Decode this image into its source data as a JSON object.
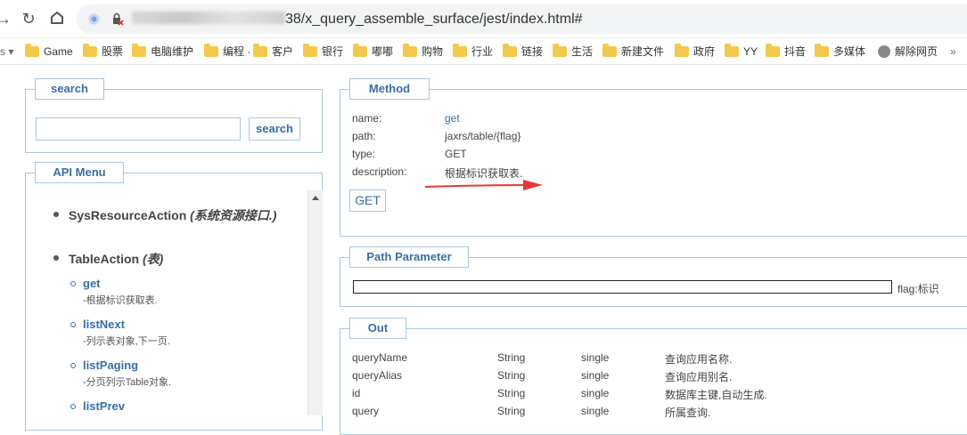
{
  "browser": {
    "url_suffix": "38/x_query_assemble_surface/jest/index.html#",
    "bookmarks": [
      "Game",
      "股票",
      "电脑维护",
      "编程",
      "客户",
      "银行",
      "嘟嘟",
      "购物",
      "行业",
      "链接",
      "生活",
      "新建文件",
      "政府",
      "YY",
      "抖音",
      "多媒体",
      "解除网页"
    ]
  },
  "search": {
    "legend": "search",
    "input_value": "",
    "button_label": "search"
  },
  "menu": {
    "legend": "API Menu",
    "groups": [
      {
        "name": "SysResourceAction",
        "desc": "(系统资源接口.)"
      },
      {
        "name": "TableAction",
        "desc": "(表)"
      }
    ],
    "items": [
      {
        "name": "get",
        "desc": "-根据标识获取表."
      },
      {
        "name": "listNext",
        "desc": "-列示表对象,下一页."
      },
      {
        "name": "listPaging",
        "desc": "-分页列示Table对象."
      },
      {
        "name": "listPrev",
        "desc": ""
      }
    ]
  },
  "method": {
    "legend": "Method",
    "labels": {
      "name": "name:",
      "path": "path:",
      "type": "type:",
      "description": "description:"
    },
    "name": "get",
    "path": "jaxrs/table/{flag}",
    "type": "GET",
    "description": "根据标识获取表.",
    "button_label": "GET"
  },
  "path_param": {
    "legend": "Path Parameter",
    "input_value": "",
    "label": "flag:标识"
  },
  "out": {
    "legend": "Out",
    "rows": [
      [
        "queryName",
        "String",
        "single",
        "查询应用名称."
      ],
      [
        "queryAlias",
        "String",
        "single",
        "查询应用别名."
      ],
      [
        "id",
        "String",
        "single",
        "数据库主键,自动生成."
      ],
      [
        "query",
        "String",
        "single",
        "所属查询."
      ]
    ]
  }
}
